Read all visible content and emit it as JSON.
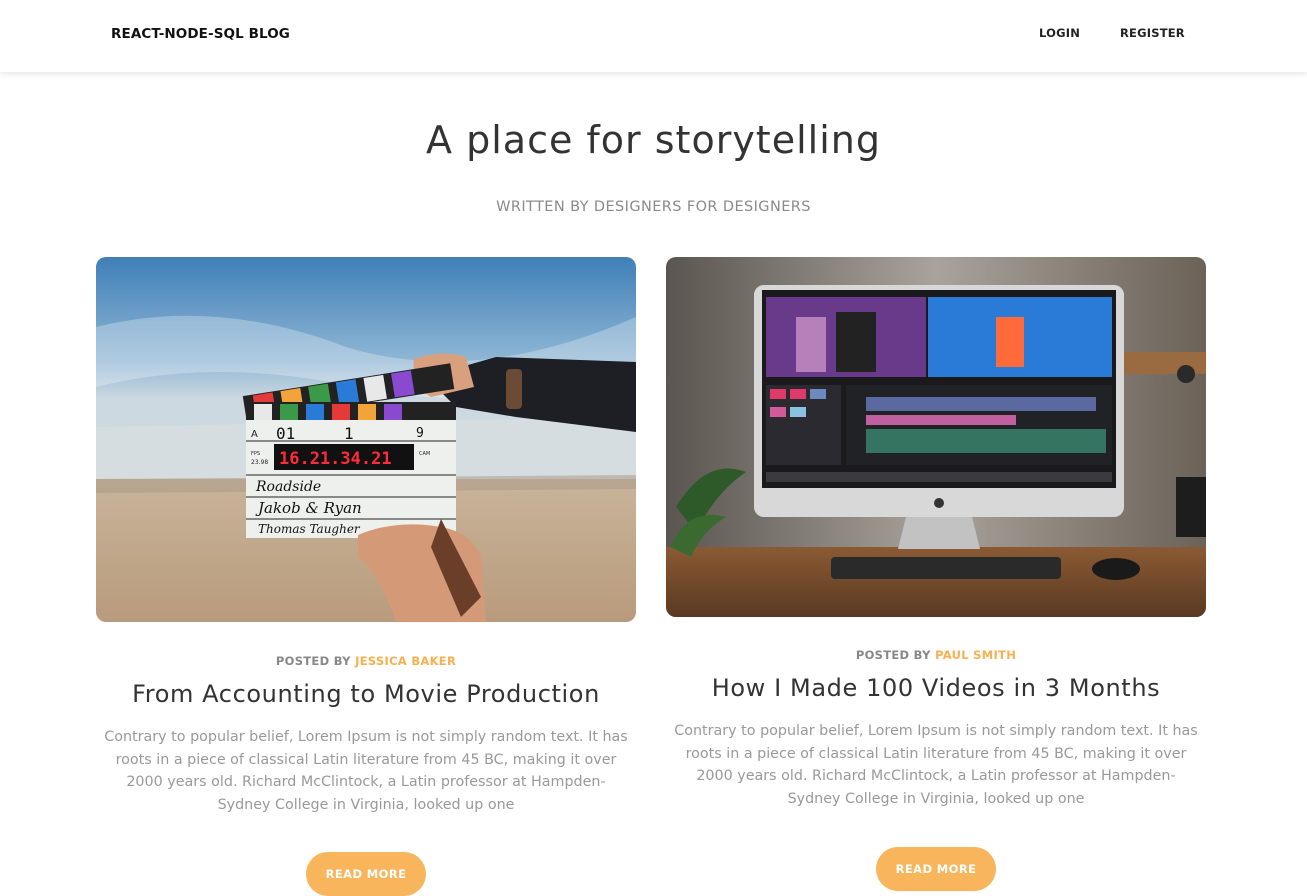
{
  "navbar": {
    "brand": "REACT-NODE-SQL BLOG",
    "login": "LOGIN",
    "register": "REGISTER"
  },
  "hero": {
    "title": "A place for storytelling",
    "subtitle": "WRITTEN BY DESIGNERS FOR DESIGNERS"
  },
  "posts": [
    {
      "posted_by_label": "POSTED BY",
      "author": "JESSICA BAKER",
      "title": "From Accounting to Movie Production",
      "excerpt": "Contrary to popular belief, Lorem Ipsum is not simply random text. It has roots in a piece of classical Latin literature from 45 BC, making it over 2000 years old. Richard McClintock, a Latin professor at Hampden-Sydney College in Virginia, looked up one",
      "button": "READ MORE",
      "image": {
        "subject": "film-clapperboard-photo",
        "clapper_text": {
          "scene": "01",
          "take": "1",
          "roll": "9",
          "timecode": "16.21.34.21",
          "production": "Roadside",
          "director": "Jakob & Ryan",
          "camera": "Thomas Taugher",
          "fps_label": "FPS",
          "fps": "23.98",
          "cam_label": "CAM",
          "scene_label": "A"
        }
      }
    },
    {
      "posted_by_label": "POSTED BY",
      "author": "PAUL SMITH",
      "title": "How I Made 100 Videos in 3 Months",
      "excerpt": "Contrary to popular belief, Lorem Ipsum is not simply random text. It has roots in a piece of classical Latin literature from 45 BC, making it over 2000 years old. Richard McClintock, a Latin professor at Hampden-Sydney College in Virginia, looked up one",
      "button": "READ MORE",
      "image": {
        "subject": "imac-video-editing-photo"
      }
    }
  ],
  "colors": {
    "accent": "#f8b55b",
    "author": "#f7b050",
    "title": "#333333",
    "muted": "#999999"
  }
}
